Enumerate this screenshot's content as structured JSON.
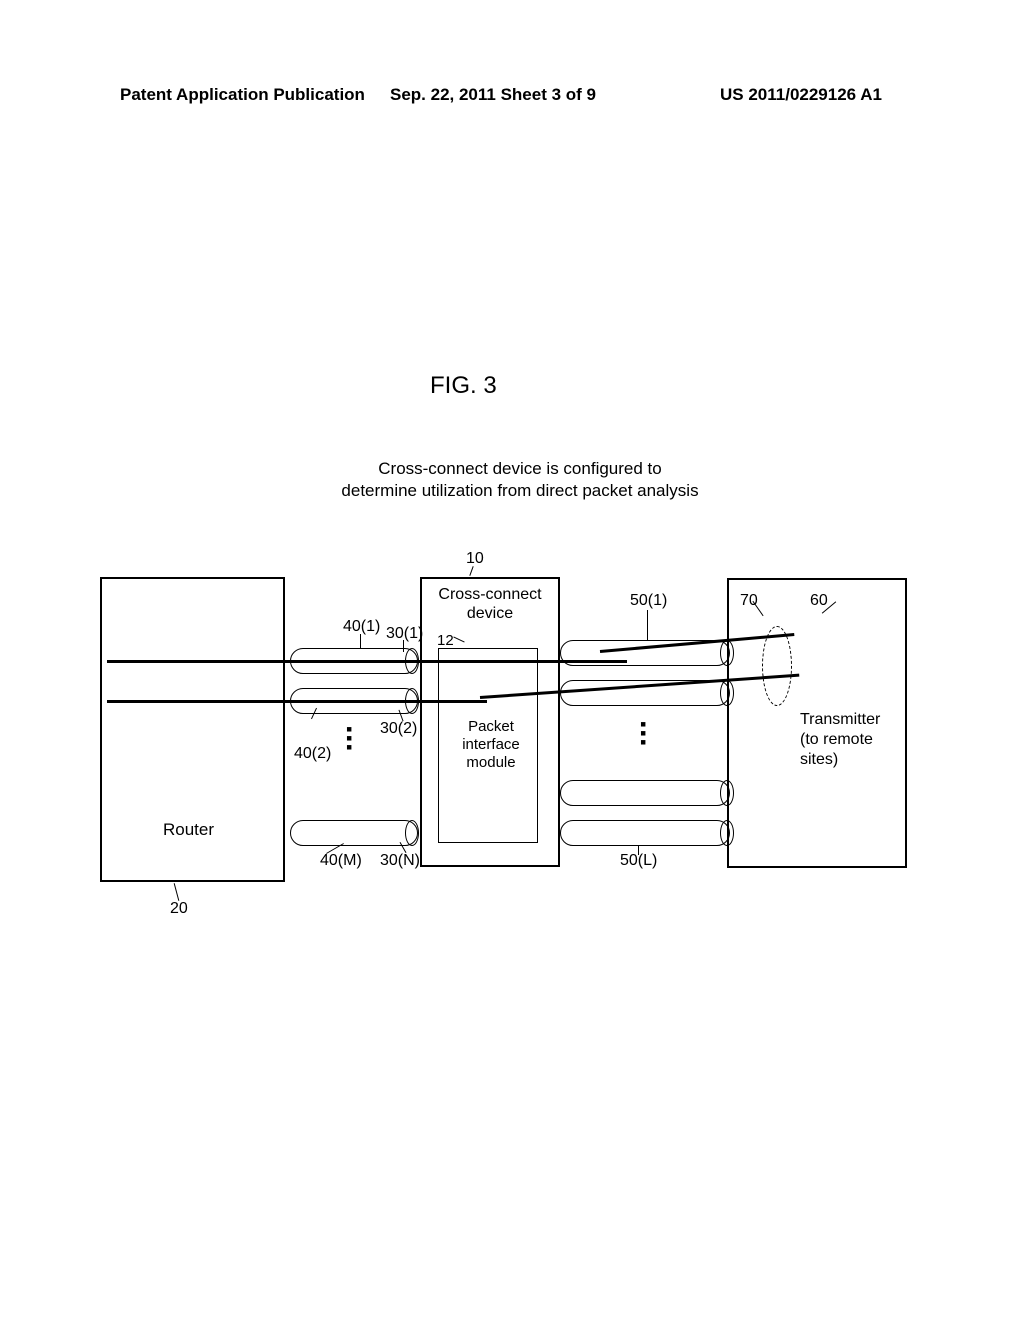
{
  "header": {
    "left": "Patent Application Publication",
    "center": "Sep. 22, 2011  Sheet 3 of 9",
    "right": "US 2011/0229126 A1"
  },
  "figure": {
    "title": "FIG. 3",
    "description": "Cross-connect device is configured to determine utilization from direct packet analysis"
  },
  "labels": {
    "ref_10": "10",
    "ref_12": "12",
    "ref_20": "20",
    "ref_30_1": "30(1)",
    "ref_30_2": "30(2)",
    "ref_30_n": "30(N)",
    "ref_40_1": "40(1)",
    "ref_40_2": "40(2)",
    "ref_40_m": "40(M)",
    "ref_50_1": "50(1)",
    "ref_50_l": "50(L)",
    "ref_60": "60",
    "ref_70": "70"
  },
  "components": {
    "router": "Router",
    "cross_connect": "Cross-connect device",
    "packet_module": "Packet interface module",
    "transmitter": "Transmitter (to remote sites)"
  },
  "dots": "▪\n▪\n▪"
}
